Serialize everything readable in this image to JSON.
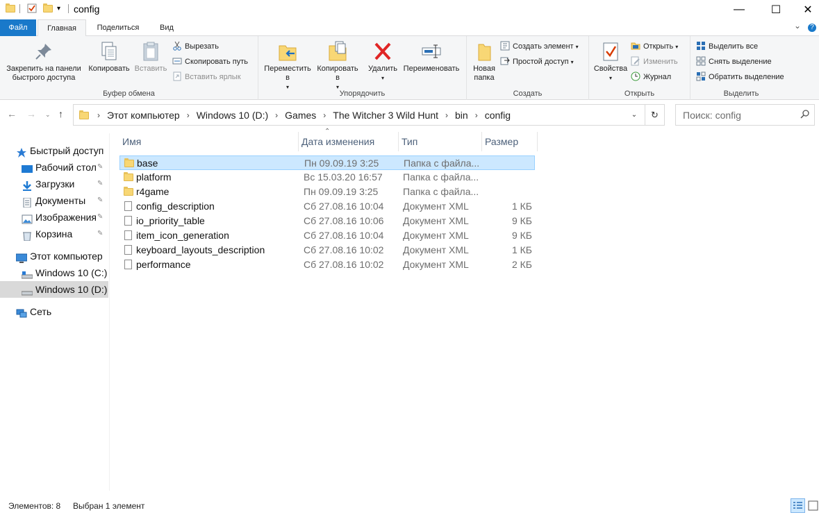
{
  "window": {
    "title": "config",
    "minimize": "—",
    "maximize": "☐",
    "close": "✕"
  },
  "ribbon_tabs": {
    "file": "Файл",
    "home": "Главная",
    "share": "Поделиться",
    "view": "Вид",
    "expand": "⌄",
    "help": "?"
  },
  "clipboard": {
    "pin": "Закрепить на панели быстрого доступа",
    "copy": "Копировать",
    "paste": "Вставить",
    "cut": "Вырезать",
    "copy_path": "Скопировать путь",
    "paste_shortcut": "Вставить ярлык",
    "label": "Буфер обмена"
  },
  "organize": {
    "move_to": "Переместить в",
    "copy_to": "Копировать в",
    "delete": "Удалить",
    "rename": "Переименовать",
    "label": "Упорядочить"
  },
  "new": {
    "new_folder": "Новая папка",
    "new_item": "Создать элемент",
    "easy_access": "Простой доступ",
    "label": "Создать"
  },
  "open": {
    "properties": "Свойства",
    "open": "Открыть",
    "edit": "Изменить",
    "history": "Журнал",
    "label": "Открыть"
  },
  "select": {
    "select_all": "Выделить все",
    "select_none": "Снять выделение",
    "invert": "Обратить выделение",
    "label": "Выделить"
  },
  "address": {
    "crumbs": [
      "Этот компьютер",
      "Windows 10 (D:)",
      "Games",
      "The Witcher 3 Wild Hunt",
      "bin",
      "config"
    ],
    "search_placeholder": "Поиск: config"
  },
  "nav": {
    "quick_access": "Быстрый доступ",
    "desktop": "Рабочий стол",
    "downloads": "Загрузки",
    "documents": "Документы",
    "pictures": "Изображения",
    "recycle": "Корзина",
    "this_pc": "Этот компьютер",
    "drive_c": "Windows 10 (C:)",
    "drive_d": "Windows 10 (D:)",
    "network": "Сеть"
  },
  "columns": {
    "name": "Имя",
    "date": "Дата изменения",
    "type": "Тип",
    "size": "Размер"
  },
  "files": [
    {
      "name": "base",
      "date": "Пн 09.09.19 3:25",
      "type": "Папка с файла...",
      "size": "",
      "kind": "folder"
    },
    {
      "name": "platform",
      "date": "Вс 15.03.20 16:57",
      "type": "Папка с файла...",
      "size": "",
      "kind": "folder"
    },
    {
      "name": "r4game",
      "date": "Пн 09.09.19 3:25",
      "type": "Папка с файла...",
      "size": "",
      "kind": "folder"
    },
    {
      "name": "config_description",
      "date": "Сб 27.08.16 10:04",
      "type": "Документ XML",
      "size": "1 КБ",
      "kind": "file"
    },
    {
      "name": "io_priority_table",
      "date": "Сб 27.08.16 10:06",
      "type": "Документ XML",
      "size": "9 КБ",
      "kind": "file"
    },
    {
      "name": "item_icon_generation",
      "date": "Сб 27.08.16 10:04",
      "type": "Документ XML",
      "size": "9 КБ",
      "kind": "file"
    },
    {
      "name": "keyboard_layouts_description",
      "date": "Сб 27.08.16 10:02",
      "type": "Документ XML",
      "size": "1 КБ",
      "kind": "file"
    },
    {
      "name": "performance",
      "date": "Сб 27.08.16 10:02",
      "type": "Документ XML",
      "size": "2 КБ",
      "kind": "file"
    }
  ],
  "status": {
    "items": "Элементов: 8",
    "selected": "Выбран 1 элемент"
  },
  "colors": {
    "accent": "#1979ca",
    "selection": "#cce8ff",
    "folder": "#f8d775"
  }
}
